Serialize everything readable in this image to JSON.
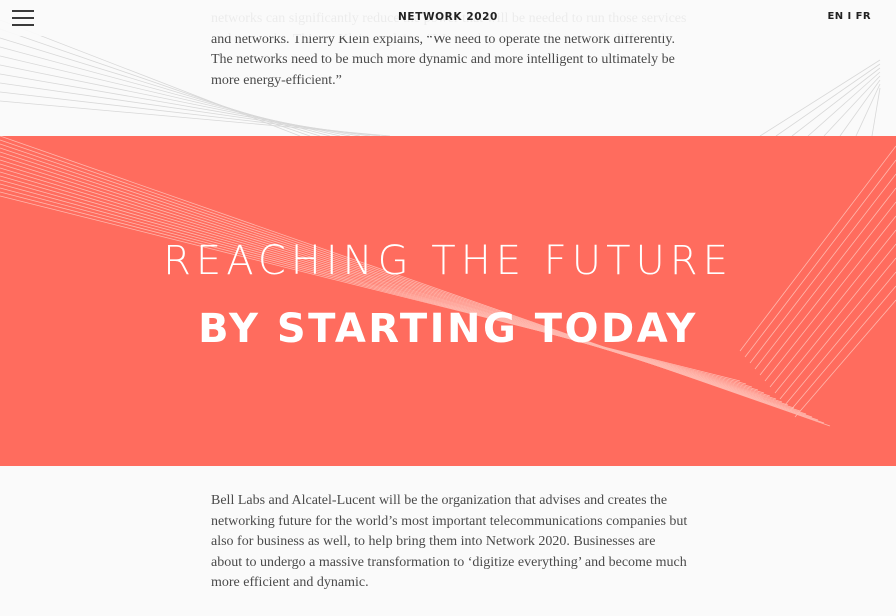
{
  "header": {
    "site_title": "NETWORK 2020",
    "lang_en": "EN",
    "lang_sep": "I",
    "lang_fr": "FR"
  },
  "intro_paragraph": "networks can significantly reduce the power that will be needed to run those services and networks. Thierry Klein explains, “We need to operate the network differently. The networks need to be much more dynamic and more intelligent to ultimately be more energy-efficient.”",
  "hero": {
    "line1": "REACHING THE FUTURE",
    "line2": "BY STARTING TODAY",
    "background_color": "#ff6c5e"
  },
  "body_paragraph": "Bell Labs and Alcatel-Lucent will be the organization that advises and creates the networking future for the world’s most important telecommunications companies but also for business as well, to help bring them into Network 2020. Businesses are about to undergo a massive transformation to ‘digitize everything’ and become much more efficient and dynamic."
}
